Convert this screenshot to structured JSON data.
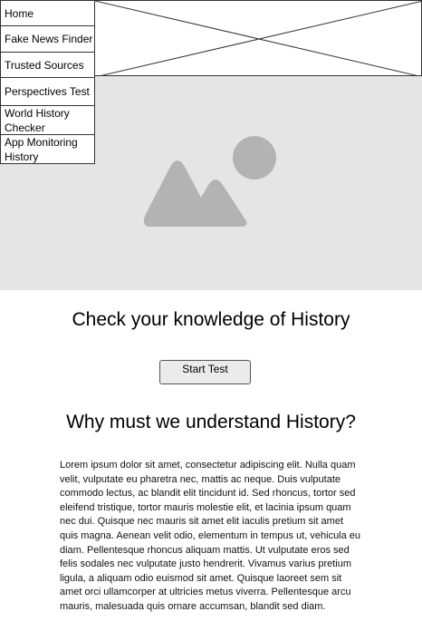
{
  "nav": {
    "items": [
      {
        "label": "Home"
      },
      {
        "label": "Fake News Finder"
      },
      {
        "label": "Trusted Sources"
      },
      {
        "label": "Perspectives Test"
      },
      {
        "label": "World History Checker"
      },
      {
        "label": "App Monitoring History"
      }
    ]
  },
  "main": {
    "knowledge_title": "Check your knowledge of History",
    "start_button": "Start Test",
    "why_title": "Why must we understand History?",
    "body_text": "Lorem ipsum dolor sit amet, consectetur adipiscing elit. Nulla quam velit, vulputate eu pharetra nec, mattis ac neque. Duis vulputate commodo lectus, ac blandit elit tincidunt id. Sed rhoncus, tortor sed eleifend tristique, tortor mauris molestie elit, et lacinia ipsum quam nec dui. Quisque nec mauris sit amet elit iaculis pretium sit amet quis magna. Aenean velit odio, elementum in tempus ut, vehicula eu diam. Pellentesque rhoncus aliquam mattis. Ut vulputate eros sed felis sodales nec vulputate justo hendrerit. Vivamus varius pretium ligula, a aliquam odio euismod sit amet. Quisque laoreet sem sit amet orci ullamcorper at ultricies metus viverra. Pellentesque arcu mauris, malesuada quis ornare accumsan, blandit sed diam."
  },
  "icons": {
    "header_placeholder": "image-placeholder-icon",
    "hero_image": "image-icon"
  },
  "colors": {
    "hero_background": "#e5e5e5",
    "hero_icon": "#b3b3b3",
    "button_background": "#ebebeb"
  }
}
